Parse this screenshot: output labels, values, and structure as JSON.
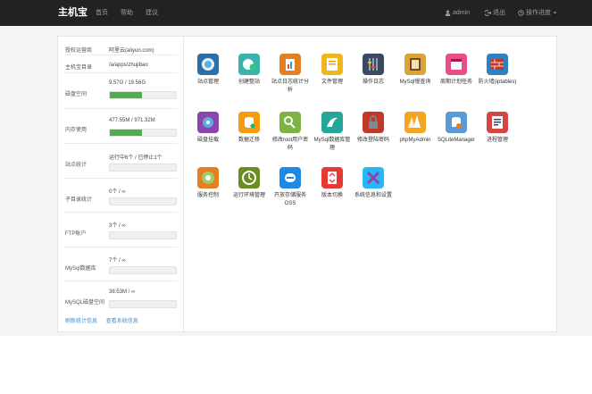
{
  "nav": {
    "brand": "主机宝",
    "links": [
      "首页",
      "帮助",
      "建议"
    ],
    "user": "admin",
    "logout": "退出",
    "advanced": "操作进度"
  },
  "stats": [
    {
      "label": "授权运营商",
      "value": "阿里云(aliyun.com)"
    },
    {
      "label": "主机宝目录",
      "value": "/a/apps/zhujibao"
    },
    {
      "label": "磁盘空间",
      "value": "9.57G / 19.56G",
      "fill": 0.49
    },
    {
      "label": "内存使用",
      "value": "477.55M / 971.32M",
      "fill": 0.49
    },
    {
      "label": "站点统计",
      "value": "运行中6个 / 已停止1个",
      "fill": 0
    },
    {
      "label": "子目录统计",
      "value": "0个 / ∞",
      "fill": 0
    },
    {
      "label": "FTP账户",
      "value": "3个 / ∞",
      "fill": 0
    },
    {
      "label": "MySql数据库",
      "value": "7个 / ∞",
      "fill": 0
    },
    {
      "label": "MySQL磁盘空间",
      "value": "38.53M / ∞",
      "fill": 0
    }
  ],
  "footer": {
    "refresh": "刷新统计信息",
    "system": "查看系统信息"
  },
  "apps": [
    {
      "label": "站点管理",
      "icon": "site-manage-icon",
      "color": "#2b6fa8"
    },
    {
      "label": "创建整站",
      "icon": "create-site-icon",
      "color": "#39b3b0"
    },
    {
      "label": "站点日志统计分析",
      "icon": "site-log-icon",
      "color": "#e67e22"
    },
    {
      "label": "文件管理",
      "icon": "file-manager-icon",
      "color": "#f0b51f"
    },
    {
      "label": "操作日志",
      "icon": "operation-log-icon",
      "color": "#3b4a63"
    },
    {
      "label": "MySql慢查询",
      "icon": "mysql-slow-icon",
      "color": "#d9a53b"
    },
    {
      "label": "周期计划任务",
      "icon": "cron-task-icon",
      "color": "#e84e8a"
    },
    {
      "label": "防火墙(iptables)",
      "icon": "firewall-icon",
      "color": "#2f7fc1"
    },
    {
      "label": "磁盘挂载",
      "icon": "disk-mount-icon",
      "color": "#8e44ad"
    },
    {
      "label": "数据迁移",
      "icon": "data-migrate-icon",
      "color": "#f39c12"
    },
    {
      "label": "修改root用户密码",
      "icon": "root-password-icon",
      "color": "#7cb342"
    },
    {
      "label": "MySql数据库管理",
      "icon": "mysql-manage-icon",
      "color": "#26a69a"
    },
    {
      "label": "修改登陆密码",
      "icon": "login-password-icon",
      "color": "#c0392b"
    },
    {
      "label": "phpMyAdmin",
      "icon": "phpmyadmin-icon",
      "color": "#f4a623"
    },
    {
      "label": "SQLiteManager",
      "icon": "sqlite-manager-icon",
      "color": "#5b9bd5"
    },
    {
      "label": "进程管理",
      "icon": "process-manage-icon",
      "color": "#d64541"
    },
    {
      "label": "服务控制",
      "icon": "service-control-icon",
      "color": "#e67e22"
    },
    {
      "label": "运行环境管理",
      "icon": "runtime-env-icon",
      "color": "#6b8e23"
    },
    {
      "label": "开放存储服务OSS",
      "icon": "oss-icon",
      "color": "#1e88e5"
    },
    {
      "label": "版本切换",
      "icon": "version-switch-icon",
      "color": "#e53935"
    },
    {
      "label": "系统信息和设置",
      "icon": "system-settings-icon",
      "color": "#29b6f6"
    }
  ]
}
